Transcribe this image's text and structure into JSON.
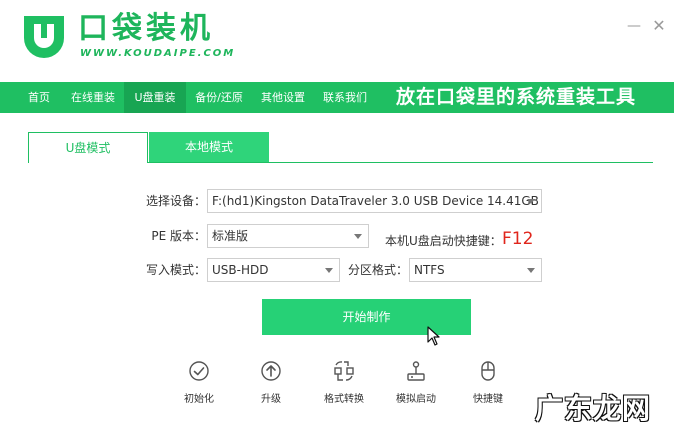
{
  "header": {
    "brand_title": "口袋装机",
    "brand_url": "WWW.KOUDAIPE.COM",
    "minimize_glyph": "—",
    "close_glyph": "✕"
  },
  "nav": {
    "items": [
      {
        "label": "首页",
        "active": false
      },
      {
        "label": "在线重装",
        "active": false
      },
      {
        "label": "U盘重装",
        "active": true
      },
      {
        "label": "备份/还原",
        "active": false
      },
      {
        "label": "其他设置",
        "active": false
      },
      {
        "label": "联系我们",
        "active": false
      }
    ],
    "slogan": "放在口袋里的系统重装工具"
  },
  "tabs": {
    "u_mode": "U盘模式",
    "local_mode": "本地模式",
    "active": "U盘模式"
  },
  "form": {
    "device_label": "选择设备：",
    "device_value": "F:(hd1)Kingston DataTraveler 3.0 USB Device 14.41GB",
    "pe_label": "PE 版本：",
    "pe_value": "标准版",
    "hotkey_label": "本机U盘启动快捷键：",
    "hotkey_value": "F12",
    "write_label": "写入模式：",
    "write_value": "USB-HDD",
    "partition_label": "分区格式：",
    "partition_value": "NTFS"
  },
  "actions": {
    "start_label": "开始制作"
  },
  "tools": [
    {
      "label": "初始化",
      "icon": "check-circle-icon"
    },
    {
      "label": "升级",
      "icon": "upload-arrow-icon"
    },
    {
      "label": "格式转换",
      "icon": "format-convert-icon"
    },
    {
      "label": "模拟启动",
      "icon": "joystick-icon"
    },
    {
      "label": "快捷键",
      "icon": "mouse-icon"
    }
  ],
  "watermark": "广东龙网",
  "colors": {
    "brand_green": "#1fbf62",
    "nav_active": "#18a553",
    "button_green": "#26d176",
    "hotkey_red": "#e0261c"
  }
}
